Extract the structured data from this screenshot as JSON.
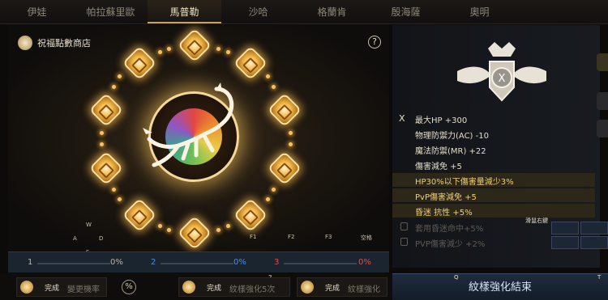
{
  "tabs": [
    "伊娃",
    "帕拉蘇里歐",
    "馬普勒",
    "沙哈",
    "格蘭肯",
    "殷海薩",
    "奧明"
  ],
  "active_tab_index": 2,
  "shop": {
    "label": "祝福點數商店",
    "icon": "blessing-shop-icon"
  },
  "help_label": "?",
  "center_icon": "scorpion-constellation-icon",
  "keys": {
    "w": "W",
    "a": "A",
    "s": "S",
    "d": "D",
    "f1": "F1",
    "f2": "F2",
    "f3": "F3",
    "space": "空格"
  },
  "progress": [
    {
      "index": "1",
      "percent": "0%",
      "color": "#b9b3a8"
    },
    {
      "index": "2",
      "percent": "0%",
      "color": "#4a8ee8"
    },
    {
      "index": "3",
      "percent": "0%",
      "color": "#e84a4a"
    }
  ],
  "bottom": {
    "slot1": {
      "done": "完成",
      "text": "變更機率"
    },
    "percent_icon": "%",
    "slot2": {
      "num": "1",
      "num2": "2",
      "done": "完成",
      "text": "紋樣強化5次"
    },
    "slot3": {
      "num": "3",
      "num2": "4",
      "num3": "E",
      "done": "完成",
      "text": "紋樣強化"
    },
    "key_q": "Q",
    "key_t": "T",
    "end_label": "紋樣強化結束"
  },
  "stats": {
    "x_label": "X",
    "lines": [
      {
        "text": "最大HP +300",
        "style": "normal"
      },
      {
        "text": "物理防禦力(AC) -10",
        "style": "normal"
      },
      {
        "text": "魔法防禦(MR) +22",
        "style": "normal"
      },
      {
        "text": "傷害減免 +5",
        "style": "normal"
      },
      {
        "text": "HP30%以下傷害量減少3%",
        "style": "gold"
      },
      {
        "text": "PvP傷害減免 +5",
        "style": "gold"
      },
      {
        "text": "昏迷 抗性 +5%",
        "style": "gold"
      },
      {
        "text": "套用昏迷命中+5%",
        "style": "dim"
      },
      {
        "text": "PVP傷害減少 +2%",
        "style": "dim"
      }
    ]
  },
  "skill_label": "滑鼠右鍵",
  "emblem_label": "X"
}
